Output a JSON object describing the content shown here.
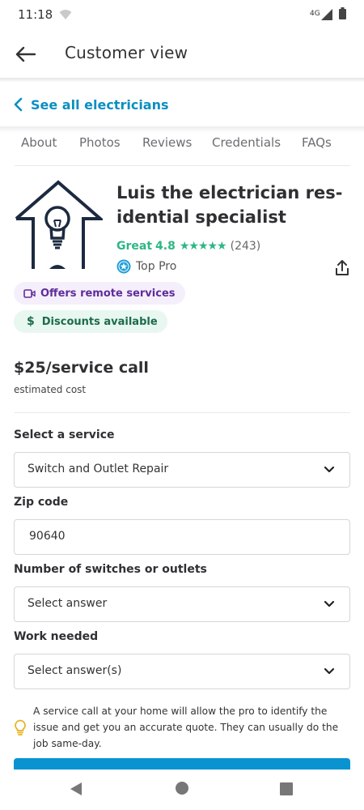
{
  "status_bar": {
    "time": "11:18",
    "network": "4G"
  },
  "app_bar": {
    "title": "Customer view"
  },
  "see_all": {
    "label": "See all electricians"
  },
  "tabs": [
    "About",
    "Photos",
    "Reviews",
    "Credentials",
    "FAQs"
  ],
  "pro": {
    "name": "Luis the electrician res-idential specialist",
    "rating_word": "Great",
    "rating_value": "4.8",
    "stars": "★★★★★",
    "review_count": "(243)",
    "top_pro_label": "Top Pro"
  },
  "badges": {
    "remote": "Offers remote services",
    "discount": "Discounts available"
  },
  "price": {
    "amount": "$25/service call",
    "subtitle": "estimated cost"
  },
  "form": {
    "service": {
      "label": "Select a service",
      "value": "Switch and Outlet Repair"
    },
    "zip": {
      "label": "Zip code",
      "value": "90640"
    },
    "switches": {
      "label": "Number of switches or outlets",
      "value": "Select answer"
    },
    "work": {
      "label": "Work needed",
      "value": "Select answer(s)"
    }
  },
  "notice": {
    "text": "A service call at your home will allow the pro to identify the issue and get you an accurate quote. They can usually do the job same-day."
  },
  "colors": {
    "accent": "#0a8fc2",
    "rating_green": "#2db783",
    "cta_blue": "#0a93d1",
    "remote_badge_bg": "#f5effc",
    "discount_badge_bg": "#e8f7f0"
  }
}
